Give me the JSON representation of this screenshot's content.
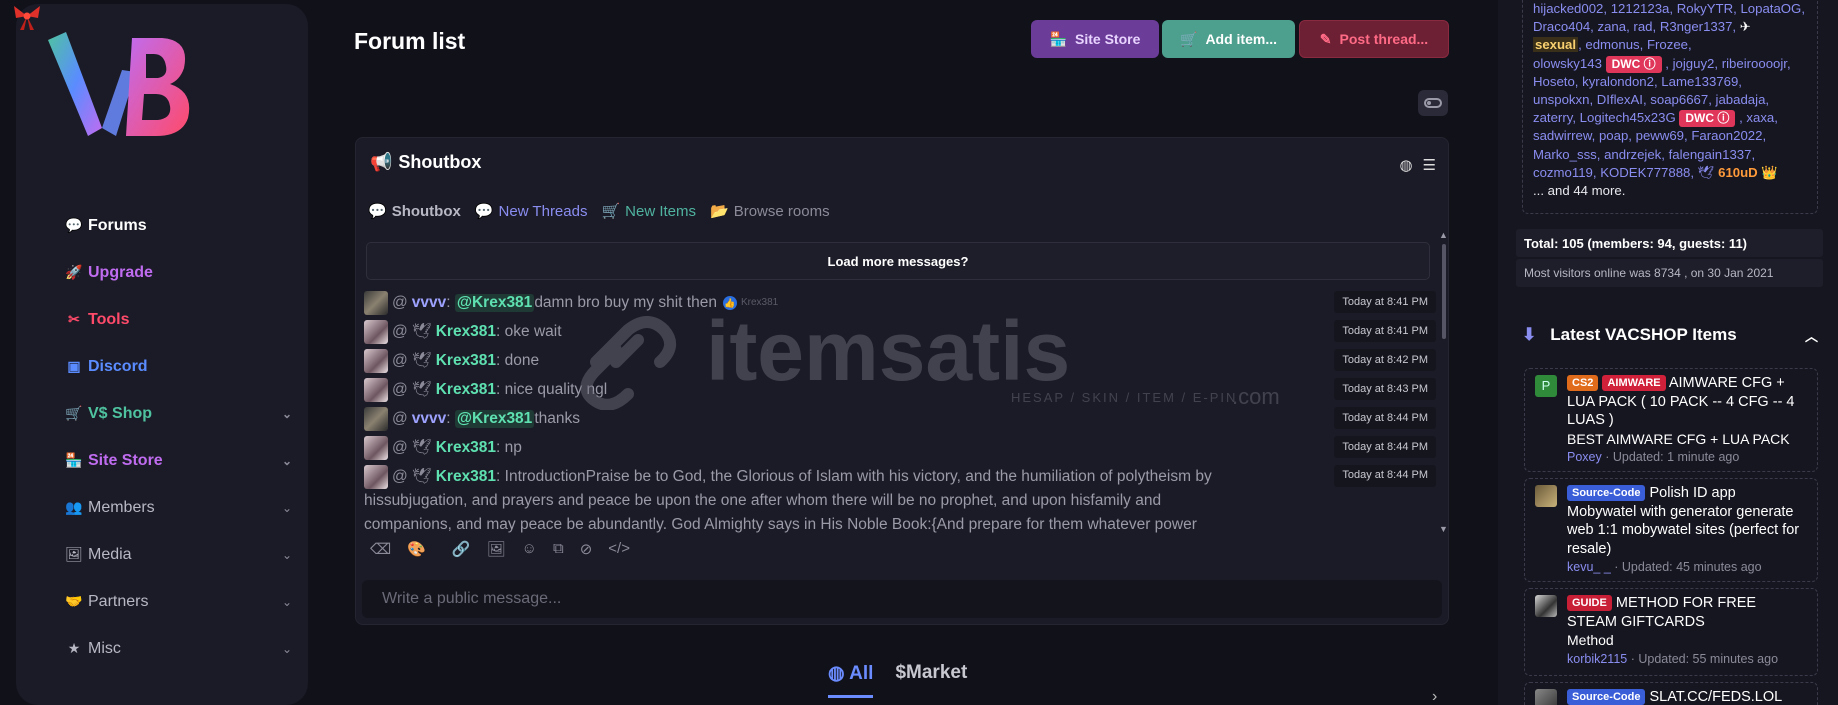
{
  "sidebar": {
    "items": [
      {
        "label": "Forums",
        "color": "#ffffff",
        "icon": "comments-icon",
        "glyph": "💬",
        "chevron": false
      },
      {
        "label": "Upgrade",
        "color": "#c06cf0",
        "icon": "rocket-icon",
        "glyph": "🚀",
        "chevron": false
      },
      {
        "label": "Tools",
        "color": "#ff4a6a",
        "icon": "tools-icon",
        "glyph": "✂",
        "chevron": false
      },
      {
        "label": "Discord",
        "color": "#5a8cff",
        "icon": "discord-icon",
        "glyph": "▣",
        "chevron": false
      },
      {
        "label": "V$ Shop",
        "color": "#4fc3a0",
        "icon": "cart-icon",
        "glyph": "🛒",
        "chevron": true
      },
      {
        "label": "Site Store",
        "color": "#c06cf0",
        "icon": "store-icon",
        "glyph": "🏪",
        "chevron": true
      },
      {
        "label": "Members",
        "color": "#b8b8c4",
        "icon": "users-icon",
        "glyph": "👥",
        "chevron": true
      },
      {
        "label": "Media",
        "color": "#b8b8c4",
        "icon": "image-icon",
        "glyph": "🖼",
        "chevron": true
      },
      {
        "label": "Partners",
        "color": "#b8b8c4",
        "icon": "handshake-icon",
        "glyph": "🤝",
        "chevron": true
      },
      {
        "label": "Misc",
        "color": "#b8b8c4",
        "icon": "star-icon",
        "glyph": "★",
        "chevron": true
      }
    ]
  },
  "header": {
    "title": "Forum list",
    "site_store": "Site Store",
    "add_item": "Add item...",
    "post_thread": "Post thread..."
  },
  "shoutbox": {
    "title": "Shoutbox",
    "tabs": {
      "shoutbox": "Shoutbox",
      "threads": "New Threads",
      "items": "New Items",
      "rooms": "Browse rooms"
    },
    "load_more": "Load more messages?",
    "input_placeholder": "Write a public message...",
    "messages": [
      {
        "user": "vvvv",
        "mention": "@Krex381",
        "text": " damn bro buy my shit then",
        "extra": "Krex381",
        "time": "Today at 8:41 PM"
      },
      {
        "user": "Krex381",
        "text": ": oke wait",
        "time": "Today at 8:41 PM"
      },
      {
        "user": "Krex381",
        "text": ": done",
        "time": "Today at 8:42 PM"
      },
      {
        "user": "Krex381",
        "text": ": nice quality ngl",
        "time": "Today at 8:43 PM"
      },
      {
        "user": "vvvv",
        "mention": "@Krex381",
        "text": " thanks",
        "time": "Today at 8:44 PM"
      },
      {
        "user": "Krex381",
        "text": ": np",
        "time": "Today at 8:44 PM"
      },
      {
        "user": "Krex381",
        "text": ": IntroductionPraise be to God, the Glorious of Islam with his victory, and the humiliation of polytheism by",
        "text2": "hissubjugation, and prayers and peace be upon the one after whom there will be no prophet, and upon hisfamily and",
        "text3": "companions, and may peace be abundantly. God Almighty says in His Noble Book:{And prepare for them whatever power",
        "time": "Today at 8:44 PM"
      }
    ]
  },
  "watermark": {
    "brand": "itemsatis",
    "tagline": "HESAP / SKIN / ITEM / E-PIN",
    "suffix": ".com"
  },
  "bottom_tabs": {
    "all": "All",
    "market": "Market"
  },
  "online": {
    "lines": [
      "hijacked002, 1212123a, RokyYTR, LopataOG,",
      "Draco404, zana, rad, R3nger1337,"
    ],
    "sexual": "sexual",
    "line3_rest": ", edmonus, Frozee,",
    "line4_a": "olowsky143",
    "dwc": "DWC",
    "line4_b": ", jojguy2, ribeiroooojr,",
    "line5": "Hoseto, kyralondon2, Lame133769,",
    "line6": "unspokxn, DIflexAI, soap6667, jabadaja,",
    "line7_a": "zaterry, Logitech45x23G",
    "line7_b": ", xaxa,",
    "line8": "sadwirrew, poap, peww69, Faraon2022,",
    "line9": "Marko_sss, andrzejek, falengain1337,",
    "line10_a": "cozmo119, KODEK777888,",
    "gold_user": "610uD",
    "more": "... and 44 more."
  },
  "stats": {
    "total": "Total: 105 (members: 94, guests: 11)",
    "most": "Most visitors online was 8734 , on 30 Jan 2021"
  },
  "vacshop": {
    "title": "Latest VACSHOP Items",
    "items": [
      {
        "tags": [
          "CS2",
          "AIMWARE"
        ],
        "title": "AIMWARE CFG + LUA PACK ( 10 PACK -- 4 CFG -- 4 LUAS )",
        "sub": "BEST AIMWARE CFG + LUA PACK",
        "author": "Poxey",
        "updated": " · Updated: 1 minute ago"
      },
      {
        "tags": [
          "Source-Code"
        ],
        "title": "Polish ID app Mobywatel with generator generate web 1:1 mobywatel sites (perfect for resale)",
        "sub": "",
        "author": "kevu_ _",
        "updated": " · Updated: 45 minutes ago"
      },
      {
        "tags": [
          "GUIDE"
        ],
        "title": "METHOD FOR FREE STEAM GIFTCARDS",
        "sub": "Method",
        "author": "korbik2115",
        "updated": " · Updated: 55 minutes ago"
      },
      {
        "tags": [
          "Source-Code"
        ],
        "title": "SLAT.CC/FEDS.LOL",
        "sub": "",
        "author": "",
        "updated": ""
      }
    ]
  }
}
